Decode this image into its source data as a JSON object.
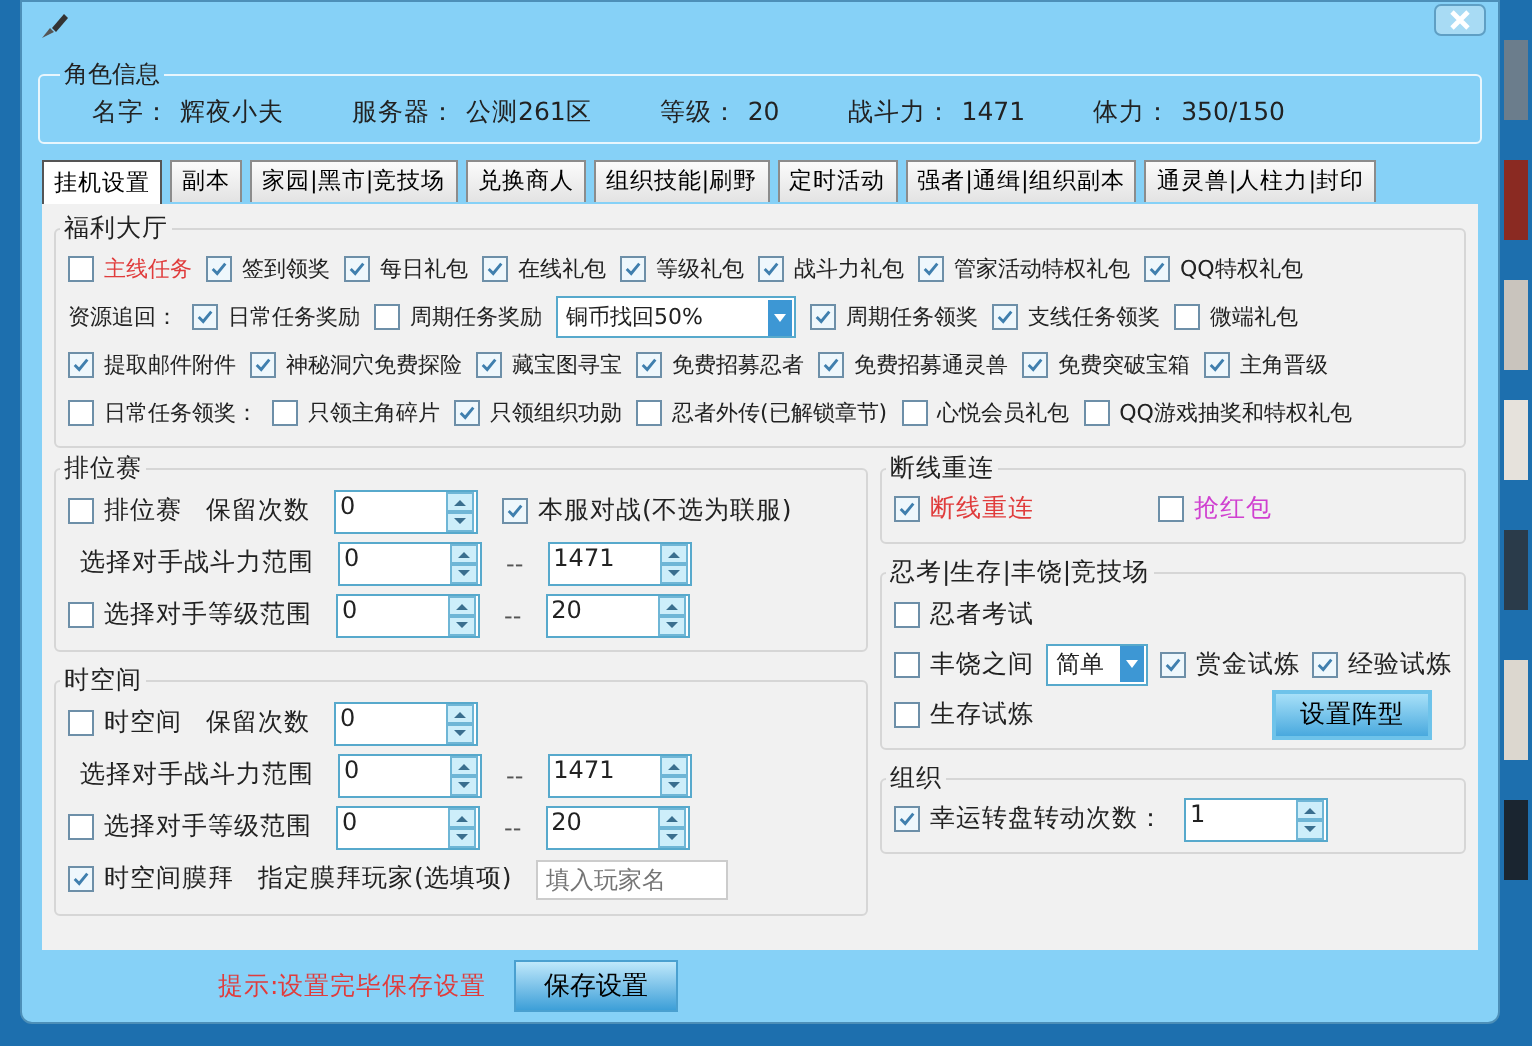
{
  "role_info": {
    "title": "角色信息",
    "fields": [
      {
        "label": "名字：",
        "value": "辉夜小夫"
      },
      {
        "label": "服务器：",
        "value": "公测261区"
      },
      {
        "label": "等级：",
        "value": "20"
      },
      {
        "label": "战斗力：",
        "value": "1471"
      },
      {
        "label": "体力：",
        "value": "350/150"
      }
    ]
  },
  "tabs": [
    {
      "label": "挂机设置",
      "selected": true
    },
    {
      "label": "副本",
      "selected": false
    },
    {
      "label": "家园|黑市|竞技场",
      "selected": false
    },
    {
      "label": "兑换商人",
      "selected": false
    },
    {
      "label": "组织技能|刷野",
      "selected": false
    },
    {
      "label": "定时活动",
      "selected": false
    },
    {
      "label": "强者|通缉|组织副本",
      "selected": false
    },
    {
      "label": "通灵兽|人柱力|封印",
      "selected": false
    }
  ],
  "welfare_hall": {
    "title": "福利大厅",
    "rows": [
      {
        "items": [
          {
            "kind": "check",
            "label": "主线任务",
            "checked": false,
            "color": "#e03c3c"
          },
          {
            "kind": "check",
            "label": "签到领奖",
            "checked": true
          },
          {
            "kind": "check",
            "label": "每日礼包",
            "checked": true
          },
          {
            "kind": "check",
            "label": "在线礼包",
            "checked": true
          },
          {
            "kind": "check",
            "label": "等级礼包",
            "checked": true
          },
          {
            "kind": "check",
            "label": "战斗力礼包",
            "checked": true
          },
          {
            "kind": "check",
            "label": "管家活动特权礼包",
            "checked": true
          },
          {
            "kind": "check",
            "label": "QQ特权礼包",
            "checked": true
          }
        ]
      },
      {
        "items": [
          {
            "kind": "label",
            "label": "资源追回："
          },
          {
            "kind": "check",
            "label": "日常任务奖励",
            "checked": true
          },
          {
            "kind": "check",
            "label": "周期任务奖励",
            "checked": false
          },
          {
            "kind": "select",
            "value": "铜币找回50%"
          },
          {
            "kind": "check",
            "label": "周期任务领奖",
            "checked": true
          },
          {
            "kind": "check",
            "label": "支线任务领奖",
            "checked": true
          },
          {
            "kind": "check",
            "label": "微端礼包",
            "checked": false
          }
        ]
      },
      {
        "items": [
          {
            "kind": "check",
            "label": "提取邮件附件",
            "checked": true
          },
          {
            "kind": "check",
            "label": "神秘洞穴免费探险",
            "checked": true
          },
          {
            "kind": "check",
            "label": "藏宝图寻宝",
            "checked": true
          },
          {
            "kind": "check",
            "label": "免费招募忍者",
            "checked": true
          },
          {
            "kind": "check",
            "label": "免费招募通灵兽",
            "checked": true
          },
          {
            "kind": "check",
            "label": "免费突破宝箱",
            "checked": true
          },
          {
            "kind": "check",
            "label": "主角晋级",
            "checked": true
          }
        ]
      },
      {
        "items": [
          {
            "kind": "check",
            "label": "日常任务领奖：",
            "checked": false
          },
          {
            "kind": "check",
            "label": "只领主角碎片",
            "checked": false
          },
          {
            "kind": "check",
            "label": "只领组织功勋",
            "checked": true
          },
          {
            "kind": "check",
            "label": "忍者外传(已解锁章节)",
            "checked": false
          },
          {
            "kind": "check",
            "label": "心悦会员礼包",
            "checked": false
          },
          {
            "kind": "check",
            "label": "QQ游戏抽奖和特权礼包",
            "checked": false
          }
        ]
      }
    ]
  },
  "ranked_match": {
    "title": "排位赛",
    "rows": [
      {
        "items": [
          {
            "kind": "check",
            "label": "排位赛",
            "checked": false
          },
          {
            "kind": "label",
            "label": "保留次数"
          },
          {
            "kind": "spin",
            "value": "0"
          },
          {
            "kind": "check",
            "label": "本服对战(不选为联服)",
            "checked": true
          }
        ]
      },
      {
        "items": [
          {
            "kind": "label",
            "label": "选择对手战斗力范围"
          },
          {
            "kind": "spin",
            "value": "0"
          },
          {
            "kind": "sep",
            "label": "--"
          },
          {
            "kind": "spin",
            "value": "1471"
          }
        ]
      },
      {
        "items": [
          {
            "kind": "check",
            "label": "选择对手等级范围",
            "checked": false
          },
          {
            "kind": "spin",
            "value": "0"
          },
          {
            "kind": "sep",
            "label": "--"
          },
          {
            "kind": "spin",
            "value": "20"
          }
        ]
      }
    ]
  },
  "space_time": {
    "title": "时空间",
    "rows": [
      {
        "items": [
          {
            "kind": "check",
            "label": "时空间",
            "checked": false
          },
          {
            "kind": "label",
            "label": "保留次数"
          },
          {
            "kind": "spin",
            "value": "0"
          }
        ]
      },
      {
        "items": [
          {
            "kind": "label",
            "label": "选择对手战斗力范围"
          },
          {
            "kind": "spin",
            "value": "0"
          },
          {
            "kind": "sep",
            "label": "--"
          },
          {
            "kind": "spin",
            "value": "1471"
          }
        ]
      },
      {
        "items": [
          {
            "kind": "check",
            "label": "选择对手等级范围",
            "checked": false
          },
          {
            "kind": "spin",
            "value": "0"
          },
          {
            "kind": "sep",
            "label": "--"
          },
          {
            "kind": "spin",
            "value": "20"
          }
        ]
      },
      {
        "items": [
          {
            "kind": "check",
            "label": "时空间膜拜",
            "checked": true
          },
          {
            "kind": "label",
            "label": "指定膜拜玩家(选填项)"
          },
          {
            "kind": "input",
            "placeholder": "填入玩家名"
          }
        ]
      }
    ]
  },
  "reconnect": {
    "title": "断线重连",
    "rows": [
      {
        "items": [
          {
            "kind": "check",
            "label": "断线重连",
            "checked": true,
            "color": "#e03c3c"
          },
          {
            "kind": "check",
            "label": "抢红包",
            "checked": false,
            "color": "#d040d0"
          }
        ]
      }
    ]
  },
  "trials": {
    "title": "忍考|生存|丰饶|竞技场",
    "rows": [
      {
        "items": [
          {
            "kind": "check",
            "label": "忍者考试",
            "checked": false
          }
        ]
      },
      {
        "items": [
          {
            "kind": "check",
            "label": "丰饶之间",
            "checked": false
          },
          {
            "kind": "select",
            "value": "简单"
          },
          {
            "kind": "check",
            "label": "赏金试炼",
            "checked": true
          },
          {
            "kind": "check",
            "label": "经验试炼",
            "checked": true
          }
        ]
      },
      {
        "items": [
          {
            "kind": "check",
            "label": "生存试炼",
            "checked": false
          },
          {
            "kind": "button",
            "label": "设置阵型"
          }
        ]
      }
    ]
  },
  "organization": {
    "title": "组织",
    "rows": [
      {
        "items": [
          {
            "kind": "check",
            "label": "幸运转盘转动次数：",
            "checked": true
          },
          {
            "kind": "spin",
            "value": "1"
          }
        ]
      }
    ]
  },
  "footer": {
    "hint": "提示:设置完毕保存设置",
    "save_button": "保存设置"
  }
}
